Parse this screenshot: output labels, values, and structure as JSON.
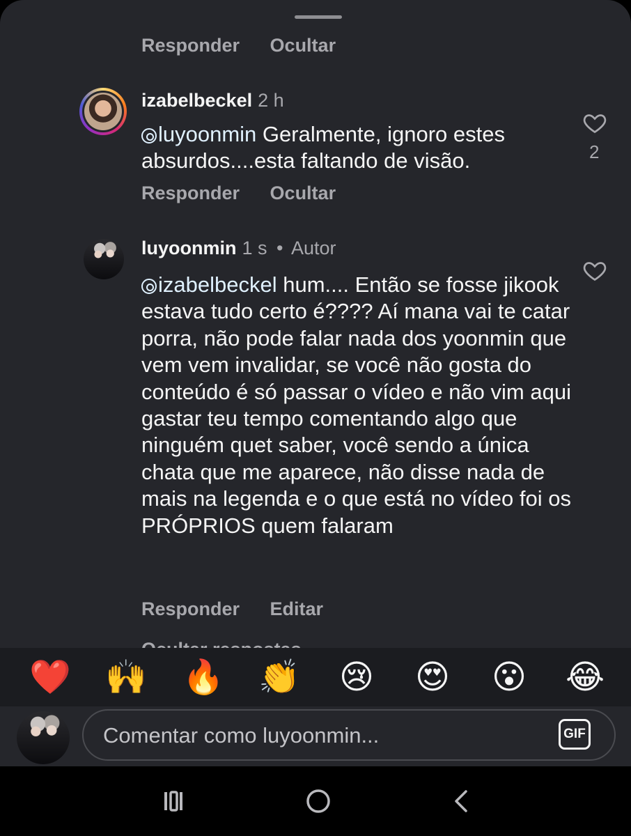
{
  "comments": [
    {
      "actions": [
        "Responder",
        "Ocultar"
      ]
    },
    {
      "username": "izabelbeckel",
      "time": "2 h",
      "mention": "luyoonmin",
      "text": " Geralmente, ignoro estes absurdos....esta faltando de visão.",
      "likes": "2",
      "actions": [
        "Responder",
        "Ocultar"
      ]
    },
    {
      "username": "luyoonmin",
      "time": "1 s",
      "separator": "•",
      "badge": "Autor",
      "mention": "izabelbeckel",
      "text": " hum.... Então se fosse jikook estava tudo certo é???? Aí mana vai te catar porra, não pode falar nada dos yoonmin que vem vem invalidar, se você não gosta do conteúdo é só passar o vídeo e não vim aqui gastar teu tempo comentando algo que ninguém quet saber, você sendo a única chata que me aparece, não disse nada de mais na legenda e o que está no vídeo foi os PRÓPRIOS quem falaram",
      "actions": [
        "Responder",
        "Editar"
      ]
    }
  ],
  "partial_row": "Ocultar respostas",
  "reactions": [
    "❤️",
    "🙌",
    "🔥",
    "👏",
    "😢",
    "😍",
    "😮",
    "😂"
  ],
  "composer": {
    "placeholder": "Comentar como luyoonmin...",
    "gif_label": "GIF"
  },
  "nav": [
    "recent-apps",
    "home",
    "back"
  ],
  "colors": {
    "sheet_bg": "#25262b",
    "secondary_text": "#a8a8ad",
    "primary_text": "#f5f5f5",
    "mention": "#e0f1ff"
  }
}
